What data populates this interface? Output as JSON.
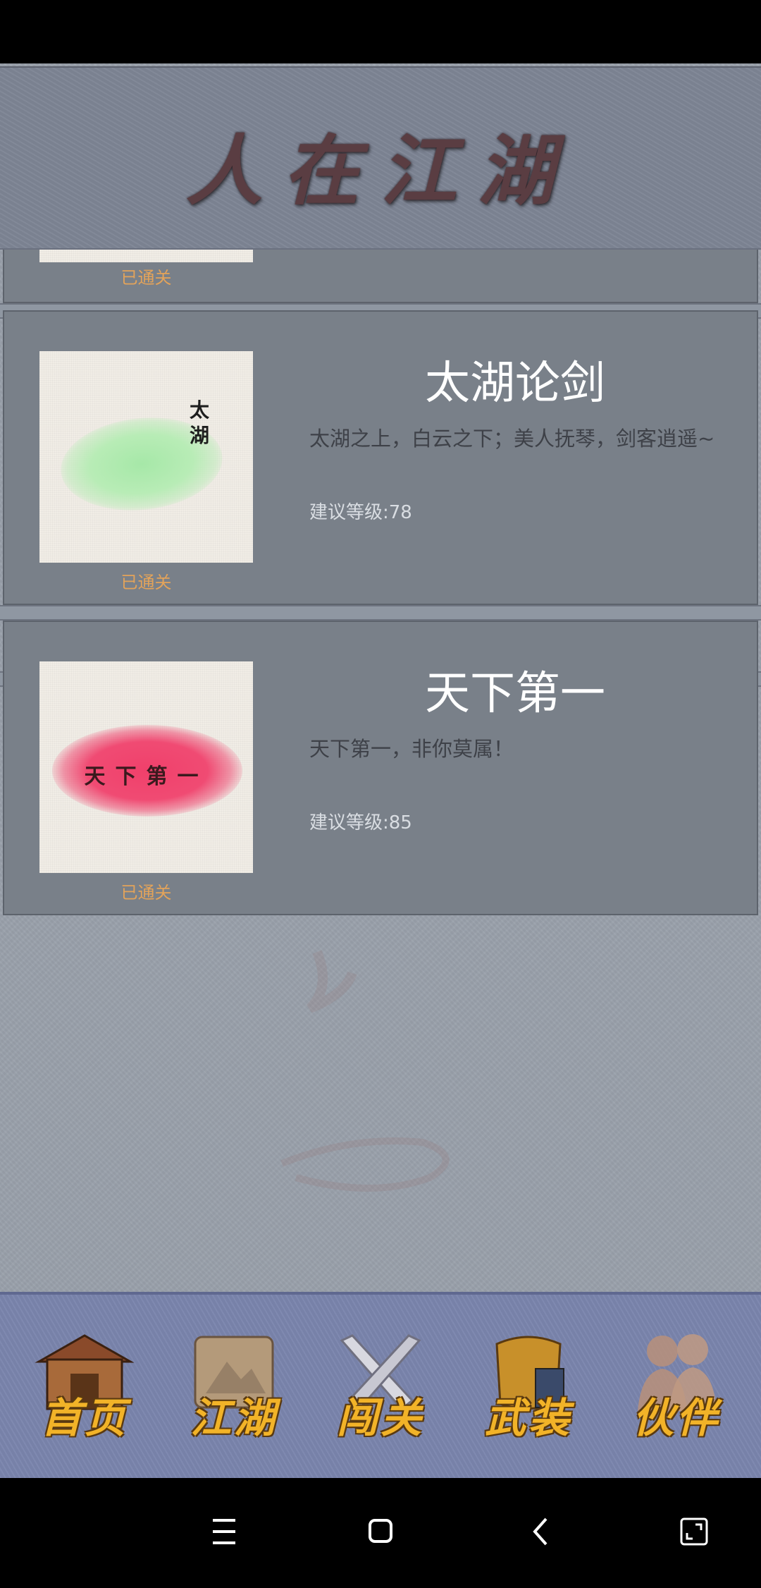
{
  "header": {
    "title": "人在江湖"
  },
  "stages": [
    {
      "status": "已通关"
    },
    {
      "thumb_text": "太湖",
      "title": "太湖论剑",
      "desc": "太湖之上，白云之下；美人抚琴，剑客逍遥~",
      "level": "建议等级:78",
      "status": "已通关"
    },
    {
      "thumb_text": "天下第一",
      "title": "天下第一",
      "desc": "天下第一，非你莫属！",
      "level": "建议等级:85",
      "status": "已通关"
    }
  ],
  "bottom_nav": [
    {
      "label": "首页",
      "icon": "house-icon"
    },
    {
      "label": "江湖",
      "icon": "scroll-map-icon"
    },
    {
      "label": "闯关",
      "icon": "crossed-swords-icon"
    },
    {
      "label": "武装",
      "icon": "armor-icon"
    },
    {
      "label": "伙伴",
      "icon": "companions-icon"
    }
  ],
  "system_nav": [
    "menu-icon",
    "home-square-icon",
    "back-icon",
    "resize-icon"
  ],
  "colors": {
    "status": "#e3a35a",
    "nav_label": "#f2b328",
    "header_bg": "#7e8595",
    "nav_bg": "#7b85ad",
    "card_bg": "#798089"
  }
}
